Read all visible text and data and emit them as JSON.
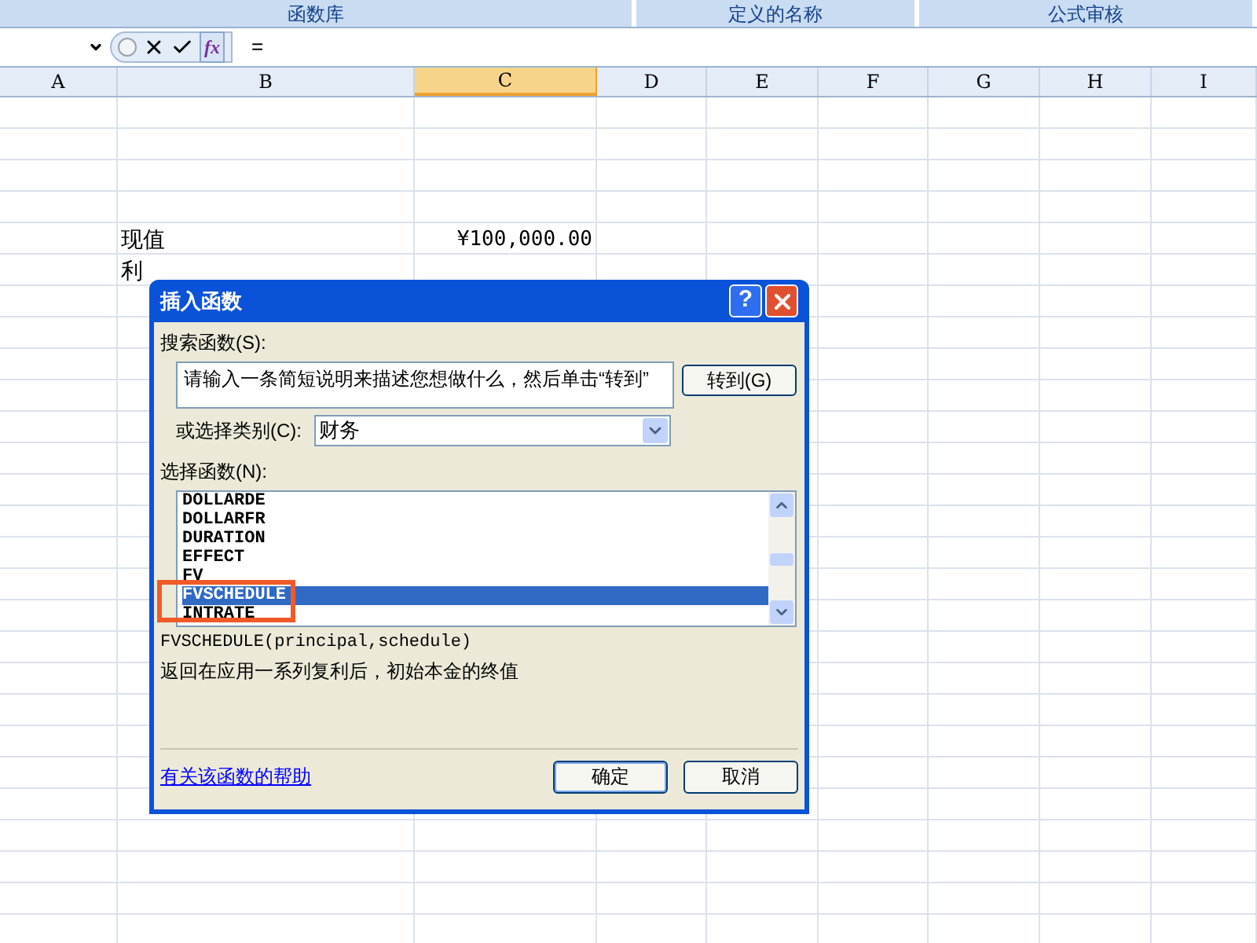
{
  "ribbon_groups": [
    "函数库",
    "定义的名称",
    "公式审核"
  ],
  "formula_bar": {
    "fx_label": "fx",
    "formula": "="
  },
  "columns": [
    {
      "label": "A",
      "selected": false
    },
    {
      "label": "B",
      "selected": false
    },
    {
      "label": "C",
      "selected": true
    },
    {
      "label": "D",
      "selected": false
    },
    {
      "label": "E",
      "selected": false
    },
    {
      "label": "F",
      "selected": false
    },
    {
      "label": "G",
      "selected": false
    },
    {
      "label": "H",
      "selected": false
    },
    {
      "label": "I",
      "selected": false
    }
  ],
  "data_rows": [
    {
      "label": "现值",
      "value": "¥100,000.00"
    },
    {
      "label": "利"
    }
  ],
  "dialog": {
    "title": "插入函数",
    "help_button": "?",
    "search_label": "搜索函数(S):",
    "search_value": "请输入一条简短说明来描述您想做什么，然后单击“转到”",
    "go_button": "转到(G)",
    "category_label": "或选择类别(C):",
    "category_value": "财务",
    "list_label": "选择函数(N):",
    "functions": [
      {
        "name": "DOLLARDE",
        "selected": false
      },
      {
        "name": "DOLLARFR",
        "selected": false
      },
      {
        "name": "DURATION",
        "selected": false
      },
      {
        "name": "EFFECT",
        "selected": false
      },
      {
        "name": "FV",
        "selected": false
      },
      {
        "name": "FVSCHEDULE",
        "selected": true
      },
      {
        "name": "INTRATE",
        "selected": false
      }
    ],
    "signature": "FVSCHEDULE(principal,schedule)",
    "description": "返回在应用一系列复利后，初始本金的终值",
    "help_link": "有关该函数的帮助",
    "buttons": [
      "确定",
      "取消"
    ]
  }
}
